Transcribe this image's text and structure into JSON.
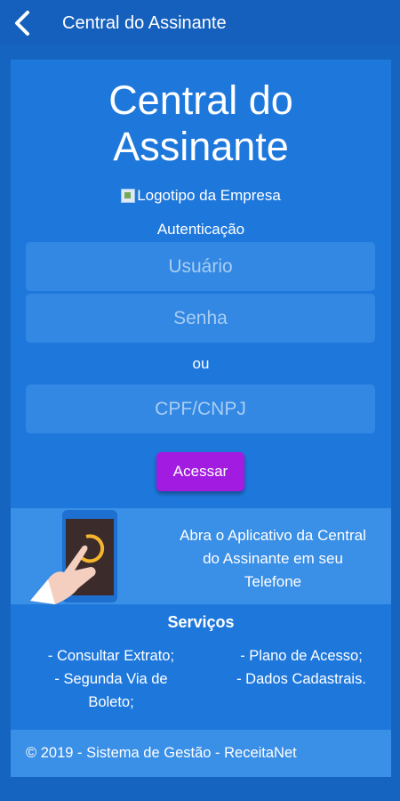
{
  "appbar": {
    "back_icon": "arrow-left-icon",
    "title": "Central do Assinante"
  },
  "card": {
    "title_line1": "Central do",
    "title_line2": "Assinante",
    "logo_alt": "Logotipo da Empresa",
    "auth_label": "Autenticação",
    "username_placeholder": "Usuário",
    "password_placeholder": "Senha",
    "or_label": "ou",
    "cpf_placeholder": "CPF/CNPJ",
    "submit_label": "Acessar"
  },
  "promo": {
    "icon": "phone-tap-icon",
    "line1": "Abra o Aplicativo da Central",
    "line2": "do Assinante em seu",
    "line3": "Telefone"
  },
  "services": {
    "title": "Serviços",
    "left": [
      "- Consultar Extrato;",
      "- Segunda Via de",
      "Boleto;"
    ],
    "right": [
      "- Plano de Acesso;",
      "- Dados Cadastrais."
    ]
  },
  "footer": {
    "text": "© 2019 - Sistema de Gestão - ReceitaNet"
  },
  "colors": {
    "background": "#1565c0",
    "card": "#1e78dc",
    "input": "#3288e3",
    "button": "#a21be0"
  }
}
